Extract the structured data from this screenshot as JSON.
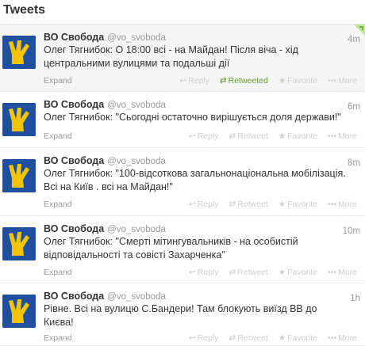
{
  "header": {
    "title": "Tweets"
  },
  "colors": {
    "avatar_bg": "#1f4f9f",
    "avatar_hand": "#f5c400",
    "retweeted": "#609928"
  },
  "tweets": [
    {
      "name": "ВО Свобода",
      "handle": "@vo_svoboda",
      "time": "4m",
      "lines": [
        "Олег Тягнибок: О 18:00 всі - на Майдан! Після віча - хід",
        "центральними вулицями та подальші дії"
      ],
      "expand": "Expand",
      "reply": "Reply",
      "retweet": "Retweeted",
      "favorite": "Favorite",
      "more": "More",
      "retweeted": true
    },
    {
      "name": "ВО Свобода",
      "handle": "@vo_svoboda",
      "time": "6m",
      "lines": [
        "Олег Тягнибок: \"Сьогодні остаточно вирішується доля держави!\""
      ],
      "expand": "Expand",
      "reply": "Reply",
      "retweet": "Retweet",
      "favorite": "Favorite",
      "more": "More",
      "retweeted": false
    },
    {
      "name": "ВО Свобода",
      "handle": "@vo_svoboda",
      "time": "8m",
      "lines": [
        "Олег Тягнибок: \"100-відсоткова загальнонаціональна мобілізація.",
        "Всі на Київ . всі на Майдан!\""
      ],
      "expand": "Expand",
      "reply": "Reply",
      "retweet": "Retweet",
      "favorite": "Favorite",
      "more": "More",
      "retweeted": false
    },
    {
      "name": "ВО Свобода",
      "handle": "@vo_svoboda",
      "time": "10m",
      "lines": [
        "Олег Тягнибок: \"Смерті мітингувальників - на особистій",
        "відповідальності та совісті Захарченка\""
      ],
      "expand": "Expand",
      "reply": "Reply",
      "retweet": "Retweet",
      "favorite": "Favorite",
      "more": "More",
      "retweeted": false
    },
    {
      "name": "ВО Свобода",
      "handle": "@vo_svoboda",
      "time": "1h",
      "lines": [
        "Рівне. Всі на вулицю С.Бандери! Там блокують виїзд ВВ до",
        "Києва!"
      ],
      "expand": "Expand",
      "reply": "Reply",
      "retweet": "Retweet",
      "favorite": "Favorite",
      "more": "More",
      "retweeted": false
    }
  ]
}
